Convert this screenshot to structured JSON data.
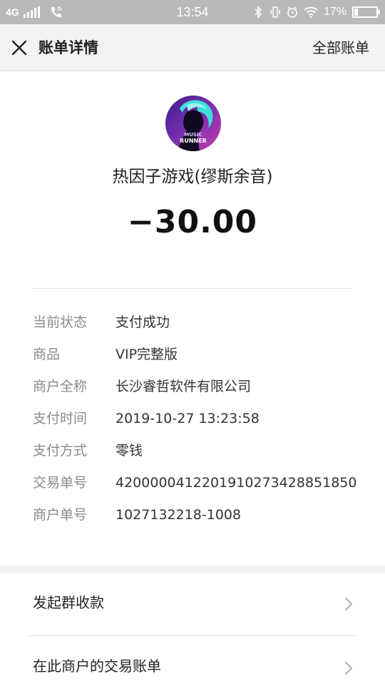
{
  "status_bar": {
    "network": "4G",
    "time": "13:54",
    "battery": "17%",
    "battery_level": 0.17
  },
  "header": {
    "title": "账单详情",
    "all_bills": "全部账单"
  },
  "merchant": {
    "avatar_text_line1": "MUSIC",
    "avatar_text_line2": "RUNNER",
    "name": "热因子游戏(缪斯余音)",
    "amount": "−30.00"
  },
  "details": [
    {
      "label": "当前状态",
      "value": "支付成功"
    },
    {
      "label": "商品",
      "value": "VIP完整版"
    },
    {
      "label": "商户全称",
      "value": "长沙睿哲软件有限公司"
    },
    {
      "label": "支付时间",
      "value": "2019-10-27 13:23:58"
    },
    {
      "label": "支付方式",
      "value": "零钱"
    },
    {
      "label": "交易单号",
      "value": "4200000412201910273428851850"
    },
    {
      "label": "商户单号",
      "value": "1027132218-1008"
    }
  ],
  "actions": [
    {
      "label": "发起群收款"
    },
    {
      "label": "在此商户的交易账单"
    }
  ],
  "colors": {
    "status_bar_bg": "#b9b9b9",
    "header_bg": "#f2f2f2",
    "label_gray": "#8a8a8a"
  }
}
